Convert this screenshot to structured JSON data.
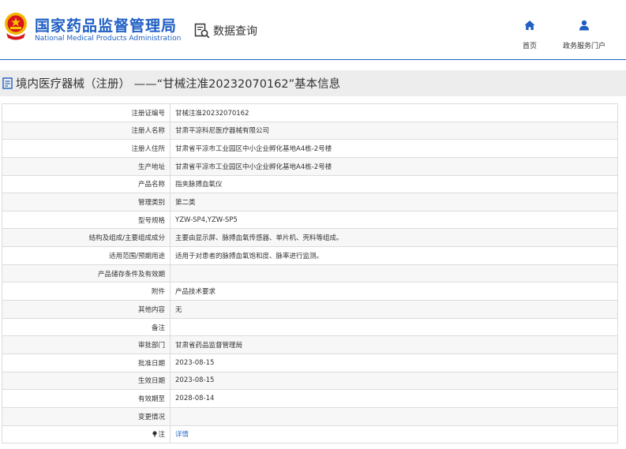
{
  "header": {
    "brand_cn": "国家药品监督管理局",
    "brand_en": "National Medical Products Administration",
    "query_label": "数据查询",
    "nav": [
      {
        "label": "首页",
        "icon": "home-icon"
      },
      {
        "label": "政务服务门户",
        "icon": "user-icon"
      }
    ],
    "accent_color": "#1f5fc4"
  },
  "page_title": "境内医疗器械（注册） ——“甘械注准20232070162”基本信息",
  "rows": [
    {
      "label": "注册证编号",
      "value": "甘械注准20232070162"
    },
    {
      "label": "注册人名称",
      "value": "甘肃平凉科尼医疗器械有限公司"
    },
    {
      "label": "注册人住所",
      "value": "甘肃省平凉市工业园区中小企业孵化基地A4栋-2号楼"
    },
    {
      "label": "生产地址",
      "value": "甘肃省平凉市工业园区中小企业孵化基地A4栋-2号楼"
    },
    {
      "label": "产品名称",
      "value": "指夹脉搏血氧仪"
    },
    {
      "label": "管理类别",
      "value": "第二类"
    },
    {
      "label": "型号规格",
      "value": "YZW-SP4,YZW-SP5"
    },
    {
      "label": "结构及组成/主要组成成分",
      "value": "主要由显示屏、脉搏血氧传感器、单片机、壳料等组成。"
    },
    {
      "label": "适用范围/预期用途",
      "value": "适用于对患者的脉搏血氧饱和度、脉率进行监测。"
    },
    {
      "label": "产品储存条件及有效期",
      "value": ""
    },
    {
      "label": "附件",
      "value": "产品技术要求"
    },
    {
      "label": "其他内容",
      "value": "无"
    },
    {
      "label": "备注",
      "value": ""
    },
    {
      "label": "审批部门",
      "value": "甘肃省药品监督管理局"
    },
    {
      "label": "批准日期",
      "value": "2023-08-15"
    },
    {
      "label": "生效日期",
      "value": "2023-08-15"
    },
    {
      "label": "有效期至",
      "value": "2028-08-14"
    },
    {
      "label": "变更情况",
      "value": ""
    }
  ],
  "note": {
    "label": "注",
    "link": "详情"
  }
}
